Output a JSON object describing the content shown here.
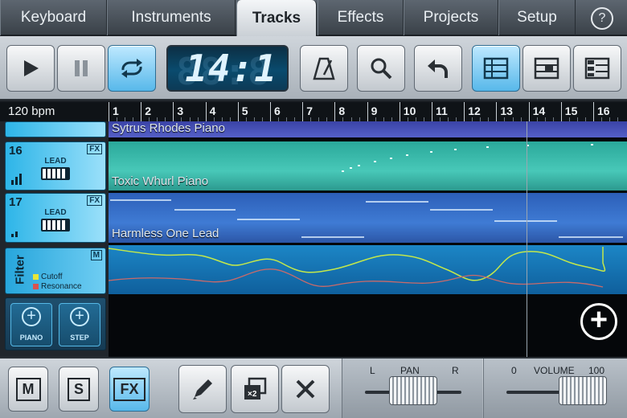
{
  "tabs": [
    {
      "label": "Keyboard",
      "active": false
    },
    {
      "label": "Instruments",
      "active": false
    },
    {
      "label": "Tracks",
      "active": true
    },
    {
      "label": "Effects",
      "active": false
    },
    {
      "label": "Projects",
      "active": false
    },
    {
      "label": "Setup",
      "active": false
    }
  ],
  "help": {
    "label": "?"
  },
  "toolbar": {
    "play_icon": "play-icon",
    "pause_icon": "pause-icon",
    "loop_icon": "loop-icon",
    "loop_on": true,
    "position_display": "14:1",
    "metronome_icon": "metronome-icon",
    "zoom_icon": "magnifier-icon",
    "undo_icon": "undo-icon",
    "view1_on": true
  },
  "bpm": "120 bpm",
  "ruler": [
    "1",
    "2",
    "3",
    "4",
    "5",
    "6",
    "7",
    "8",
    "9",
    "10",
    "11",
    "12",
    "13",
    "14",
    "15",
    "16"
  ],
  "tracks": [
    {
      "number": "",
      "pattern": "Sytrus Rhodes Piano"
    },
    {
      "number": "16",
      "fx": "FX",
      "type": "LEAD",
      "pattern": "Toxic Whurl Piano"
    },
    {
      "number": "17",
      "fx": "FX",
      "type": "LEAD",
      "pattern": "Harmless One Lead"
    }
  ],
  "filter": {
    "label": "Filter",
    "m_badge": "M",
    "legend": [
      {
        "name": "Cutoff",
        "color": "#e6e63a"
      },
      {
        "name": "Resonance",
        "color": "#d9534f"
      }
    ]
  },
  "add_buttons": [
    {
      "label": "PIANO"
    },
    {
      "label": "STEP"
    }
  ],
  "bottom": {
    "mute": "M",
    "solo": "S",
    "fx": "FX",
    "pan": {
      "title": "PAN",
      "left": "L",
      "right": "R",
      "value": 0.5
    },
    "volume": {
      "title": "VOLUME",
      "min": "0",
      "max": "100",
      "value": 0.78
    }
  },
  "colors": {
    "accent": "#2db5e8",
    "cutoff": "#e6e63a",
    "resonance": "#d9534f"
  }
}
